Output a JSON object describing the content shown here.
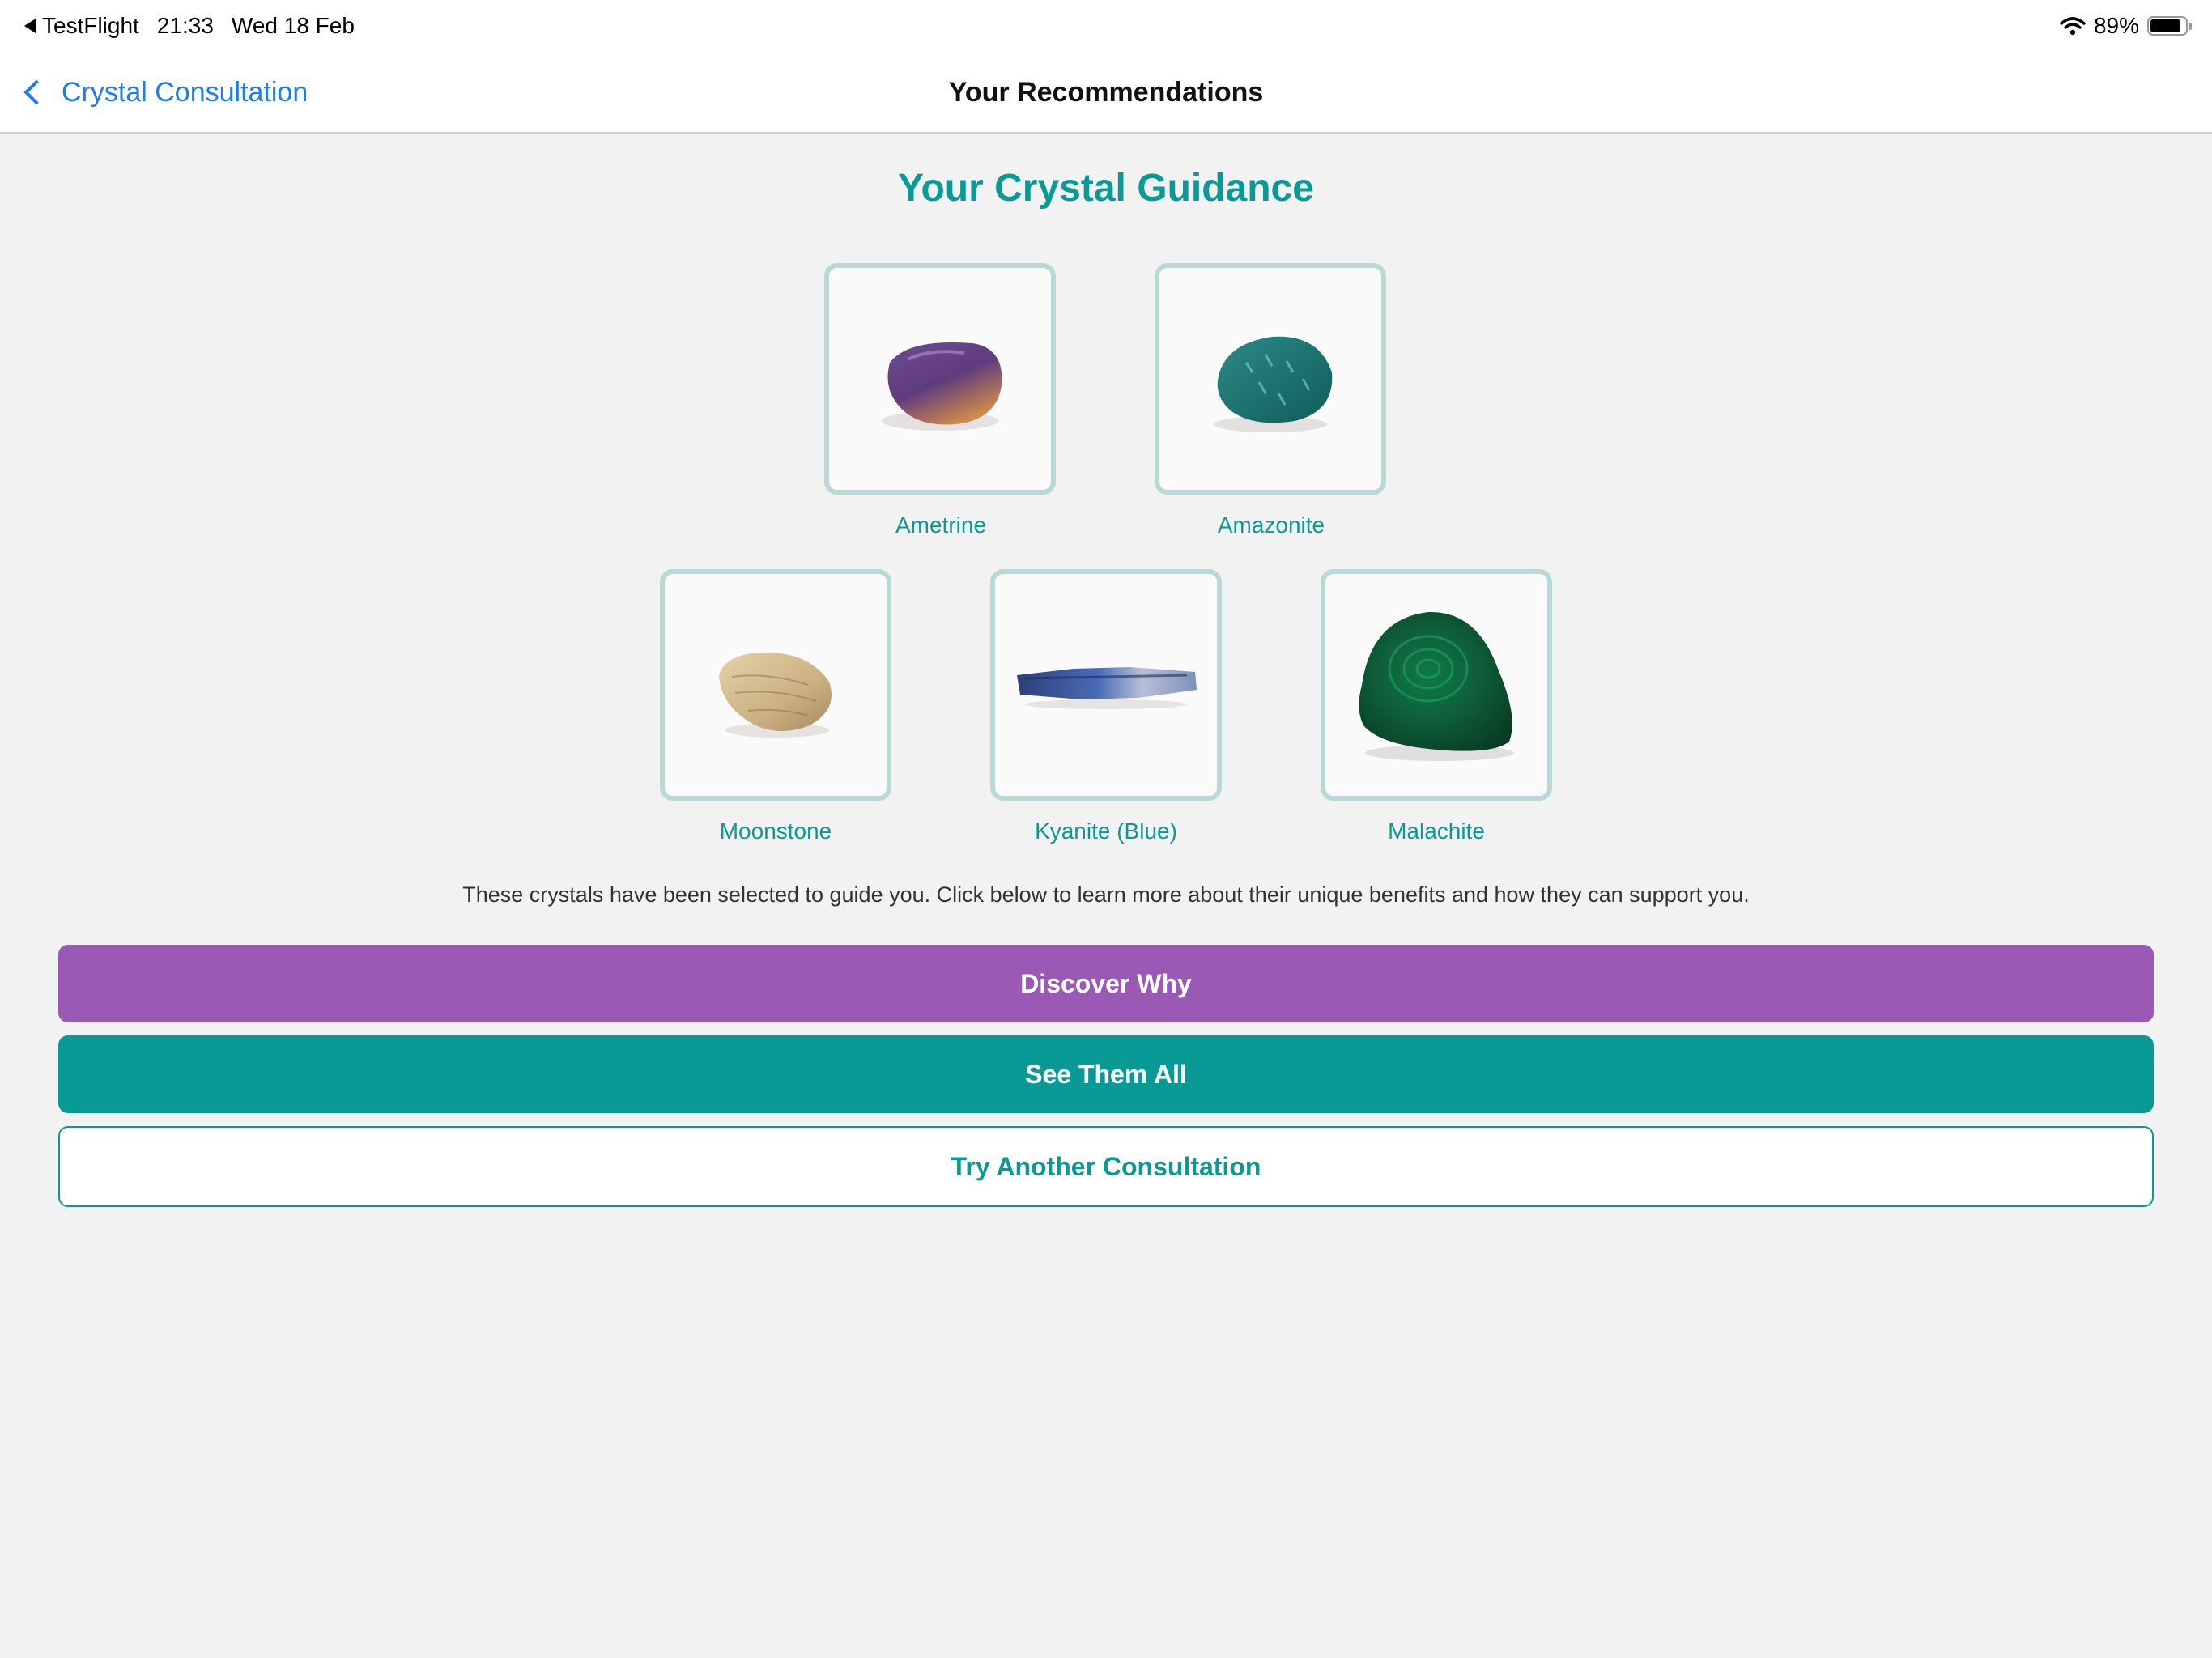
{
  "status_bar": {
    "back_app": "TestFlight",
    "time": "21:33",
    "date": "Wed 18 Feb",
    "battery": "89%",
    "battery_level": 0.89
  },
  "nav": {
    "back_label": "Crystal Consultation",
    "title": "Your Recommendations"
  },
  "main": {
    "heading": "Your Crystal Guidance",
    "crystals": [
      {
        "name": "Ametrine"
      },
      {
        "name": "Amazonite"
      },
      {
        "name": "Moonstone"
      },
      {
        "name": "Kyanite (Blue)"
      },
      {
        "name": "Malachite"
      }
    ],
    "description": "These crystals have been selected to guide you. Click below to learn more about their unique benefits and how they can support you."
  },
  "buttons": {
    "discover": "Discover Why",
    "see_all": "See Them All",
    "try_another": "Try Another Consultation"
  },
  "colors": {
    "accent_teal": "#0a9a95",
    "accent_purple": "#9b59b6",
    "link_blue": "#1a7ef2",
    "tile_border": "#b9d9d6"
  }
}
